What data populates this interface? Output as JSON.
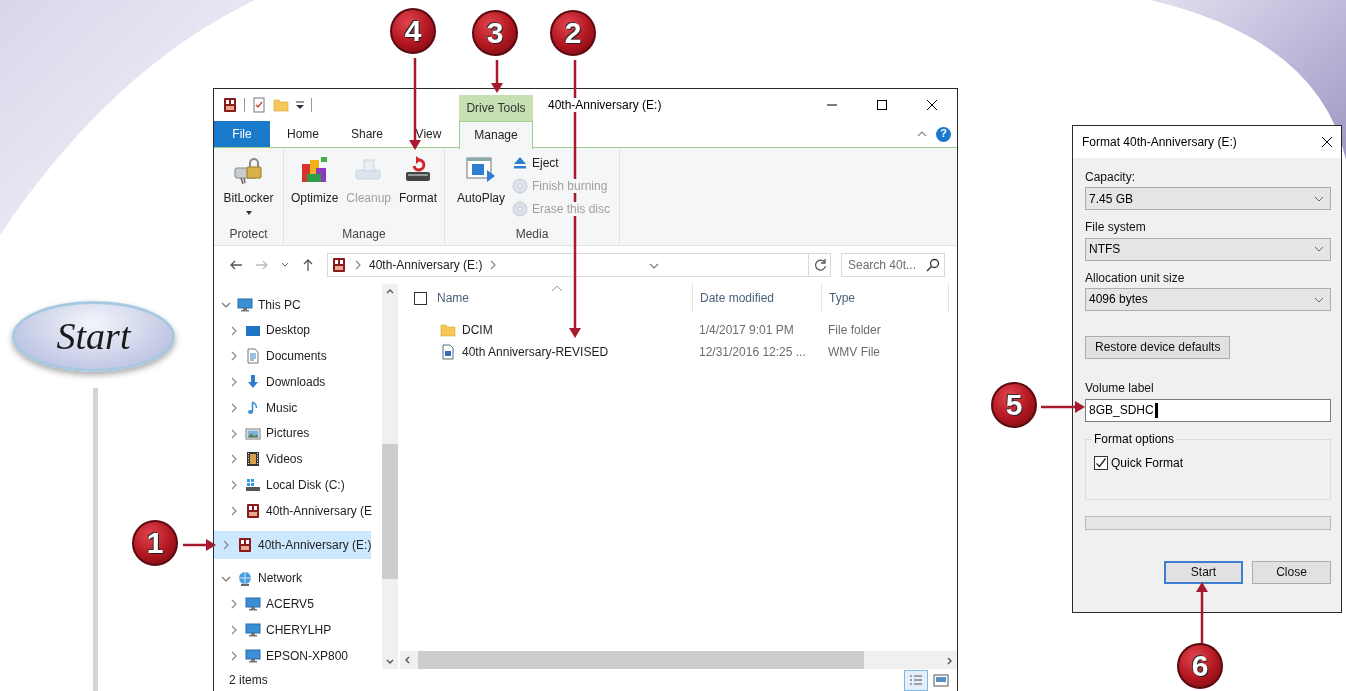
{
  "start_badge": {
    "label": "Start"
  },
  "callouts": [
    {
      "number": "4"
    },
    {
      "number": "3"
    },
    {
      "number": "2"
    },
    {
      "number": "5"
    },
    {
      "number": "1"
    },
    {
      "number": "6"
    }
  ],
  "explorer": {
    "title": "40th-Anniversary (E:)",
    "context_tab": {
      "label": "Drive Tools"
    },
    "ribbon_tabs": [
      {
        "label": "File",
        "kind": "file",
        "selected": false
      },
      {
        "label": "Home",
        "kind": "tab",
        "selected": false
      },
      {
        "label": "Share",
        "kind": "tab",
        "selected": false
      },
      {
        "label": "View",
        "kind": "tab",
        "selected": false
      },
      {
        "label": "Manage",
        "kind": "tab",
        "selected": true
      }
    ],
    "help_button": "?",
    "ribbon_groups": [
      {
        "label": "Protect",
        "commands": [
          {
            "label": "BitLocker",
            "kind": "large",
            "disabled": false,
            "dropdown": true
          }
        ]
      },
      {
        "label": "Manage",
        "commands": [
          {
            "label": "Optimize",
            "kind": "large",
            "disabled": false,
            "dropdown": false
          },
          {
            "label": "Cleanup",
            "kind": "large",
            "disabled": true,
            "dropdown": false
          },
          {
            "label": "Format",
            "kind": "large",
            "disabled": false,
            "dropdown": false
          }
        ]
      },
      {
        "label": "Media",
        "commands": [
          {
            "label": "AutoPlay",
            "kind": "large",
            "disabled": false,
            "dropdown": false
          },
          {
            "label": "Eject",
            "kind": "small",
            "disabled": false,
            "dropdown": false
          },
          {
            "label": "Finish burning",
            "kind": "small",
            "disabled": true,
            "dropdown": false
          },
          {
            "label": "Erase this disc",
            "kind": "small",
            "disabled": true,
            "dropdown": false
          }
        ]
      }
    ],
    "address": {
      "path": "40th-Anniversary (E:)"
    },
    "search": {
      "placeholder": "Search 40t..."
    },
    "nav_tree": [
      {
        "label": "This PC",
        "kind": "pc",
        "expanded": true,
        "selected": false,
        "children": [
          {
            "label": "Desktop",
            "kind": "desktop",
            "expanded": false,
            "selected": false
          },
          {
            "label": "Documents",
            "kind": "documents",
            "expanded": false,
            "selected": false
          },
          {
            "label": "Downloads",
            "kind": "downloads",
            "expanded": false,
            "selected": false
          },
          {
            "label": "Music",
            "kind": "music",
            "expanded": false,
            "selected": false
          },
          {
            "label": "Pictures",
            "kind": "pictures",
            "expanded": false,
            "selected": false
          },
          {
            "label": "Videos",
            "kind": "videos",
            "expanded": false,
            "selected": false
          },
          {
            "label": "Local Disk (C:)",
            "kind": "disk",
            "expanded": false,
            "selected": false
          },
          {
            "label": "40th-Anniversary (E",
            "kind": "sd",
            "expanded": false,
            "selected": false
          }
        ]
      },
      {
        "label": "40th-Anniversary (E:)",
        "kind": "sd",
        "expanded": false,
        "selected": true
      },
      {
        "label": "Network",
        "kind": "network",
        "expanded": true,
        "selected": false,
        "children": [
          {
            "label": "ACERV5",
            "kind": "computer",
            "expanded": false,
            "selected": false
          },
          {
            "label": "CHERYLHP",
            "kind": "computer",
            "expanded": false,
            "selected": false
          },
          {
            "label": "EPSON-XP800",
            "kind": "computer",
            "expanded": false,
            "selected": false
          }
        ]
      }
    ],
    "select_all": {
      "checked": false
    },
    "columns": [
      {
        "label": "Name",
        "sorted": true
      },
      {
        "label": "Date modified",
        "sorted": false
      },
      {
        "label": "Type",
        "sorted": false
      }
    ],
    "files": [
      {
        "name": "DCIM",
        "date_modified": "1/4/2017 9:01 PM",
        "type": "File folder",
        "kind": "folder"
      },
      {
        "name": "40th Anniversary-REVISED",
        "date_modified": "12/31/2016 12:25 ...",
        "type": "WMV File",
        "kind": "video"
      }
    ],
    "status_bar": {
      "item_count": "2 items"
    },
    "view_buttons": [
      {
        "kind": "details",
        "selected": true
      },
      {
        "kind": "large_icons",
        "selected": false
      }
    ]
  },
  "format_dialog": {
    "title": "Format 40th-Anniversary (E:)",
    "fields": [
      {
        "label": "Capacity:",
        "value": "7.45 GB"
      },
      {
        "label": "File system",
        "value": "NTFS"
      },
      {
        "label": "Allocation unit size",
        "value": "4096 bytes"
      }
    ],
    "restore_button": "Restore device defaults",
    "volume_label": {
      "label": "Volume label",
      "value": "8GB_SDHC"
    },
    "format_options": {
      "label": "Format options",
      "options": [
        {
          "label": "Quick Format",
          "checked": true
        }
      ]
    },
    "progress": {
      "level": 0
    },
    "buttons": [
      {
        "label": "Start",
        "default": true
      },
      {
        "label": "Close",
        "default": false
      }
    ]
  }
}
